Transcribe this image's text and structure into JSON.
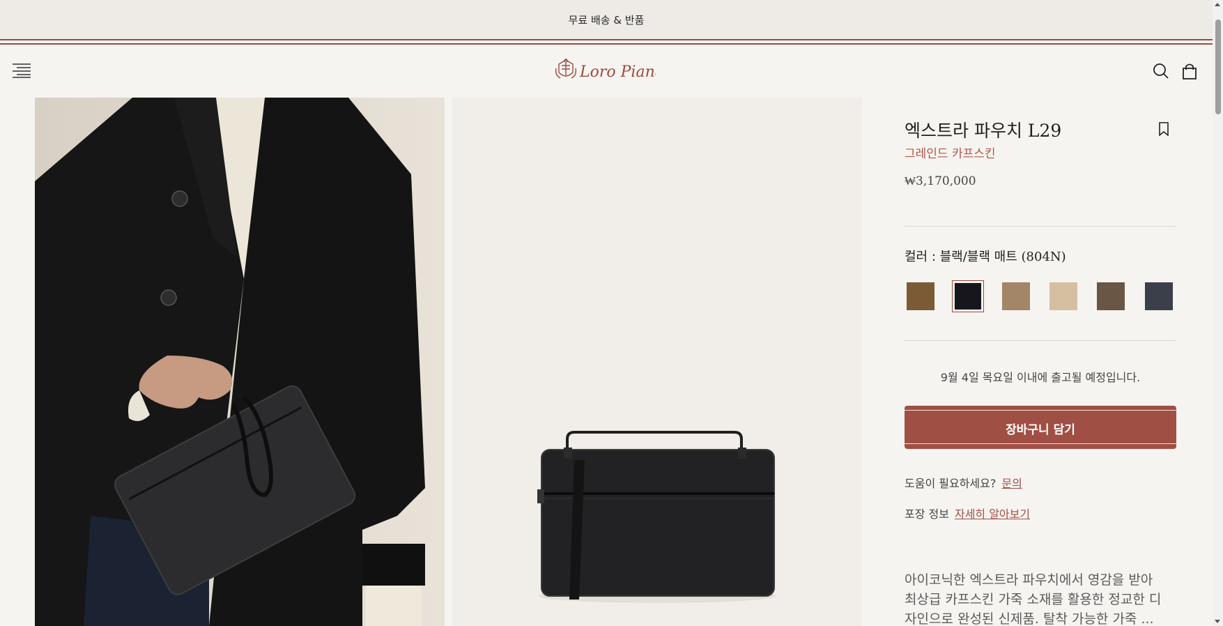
{
  "promo": {
    "text": "무료 배송 & 반품"
  },
  "header": {
    "menu_icon": "hamburger-menu-icon",
    "logo_icon": "loro-piana-logo",
    "logo_text": "Loro Piana",
    "search_icon": "search-icon",
    "cart_icon": "shopping-bag-icon"
  },
  "gallery": {
    "images": [
      {
        "description_icon": "model-holding-pouch-photo"
      },
      {
        "description_icon": "pouch-product-photo"
      }
    ]
  },
  "product": {
    "title": "엑스트라 파우치 L29",
    "subtitle": "그레인드 카프스킨",
    "price": "₩3,170,000",
    "bookmark_icon": "bookmark-icon",
    "color_label": "컬러 : 블랙/블랙 매트",
    "color_code": "(804N)",
    "swatches": [
      {
        "color": "#7a5b36",
        "selected": false
      },
      {
        "color": "#17161c",
        "selected": true
      },
      {
        "color": "#a38567",
        "selected": false
      },
      {
        "color": "#d5bfa1",
        "selected": false
      },
      {
        "color": "#6a5644",
        "selected": false
      },
      {
        "color": "#3a3f49",
        "selected": false
      }
    ],
    "shipping_note": "9월 4일 목요일 이내에 출고될 예정입니다.",
    "add_to_cart": "장바구니 담기",
    "help_text": "도움이 필요하세요?",
    "help_link": "문의",
    "packaging_text": "포장 정보",
    "packaging_link": "자세히 알아보기",
    "description_lines": [
      "아이코닉한 엑스트라 파우치에서 영감을 받아",
      "최상급 카프스킨 가죽 소재를 활용한 정교한 디",
      "자인으로 완성된 신제품. 탈착 가능한 가죽 ..."
    ]
  },
  "colors": {
    "accent": "#a04f44",
    "subtitle": "#b2554a",
    "background": "#f6f4f0",
    "promo_background": "#eeebe6"
  }
}
